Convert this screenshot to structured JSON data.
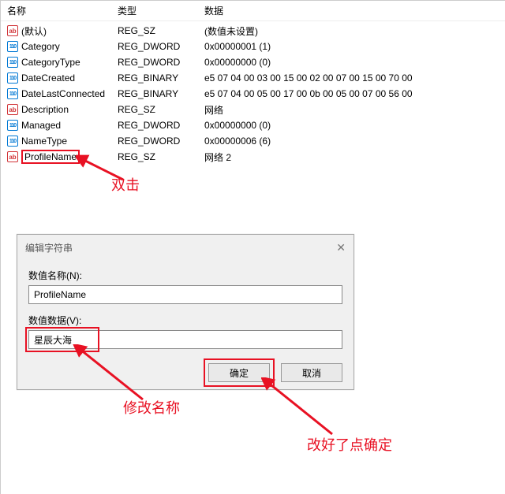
{
  "headers": {
    "name": "名称",
    "type": "类型",
    "data": "数据"
  },
  "rows": [
    {
      "icon": "sz",
      "name": "(默认)",
      "type": "REG_SZ",
      "data": "(数值未设置)"
    },
    {
      "icon": "bin",
      "name": "Category",
      "type": "REG_DWORD",
      "data": "0x00000001 (1)"
    },
    {
      "icon": "bin",
      "name": "CategoryType",
      "type": "REG_DWORD",
      "data": "0x00000000 (0)"
    },
    {
      "icon": "bin",
      "name": "DateCreated",
      "type": "REG_BINARY",
      "data": "e5 07 04 00 03 00 15 00 02 00 07 00 15 00 70 00"
    },
    {
      "icon": "bin",
      "name": "DateLastConnected",
      "type": "REG_BINARY",
      "data": "e5 07 04 00 05 00 17 00 0b 00 05 00 07 00 56 00"
    },
    {
      "icon": "sz",
      "name": "Description",
      "type": "REG_SZ",
      "data": "网络"
    },
    {
      "icon": "bin",
      "name": "Managed",
      "type": "REG_DWORD",
      "data": "0x00000000 (0)"
    },
    {
      "icon": "bin",
      "name": "NameType",
      "type": "REG_DWORD",
      "data": "0x00000006 (6)"
    },
    {
      "icon": "sz",
      "name": "ProfileName",
      "type": "REG_SZ",
      "data": "网络 2",
      "highlight": true
    }
  ],
  "annotations": {
    "doubleclick": "双击",
    "rename": "修改名称",
    "confirm": "改好了点确定"
  },
  "dialog": {
    "title": "编辑字符串",
    "name_label": "数值名称(N):",
    "name_value": "ProfileName",
    "data_label": "数值数据(V):",
    "data_value": "星辰大海",
    "ok": "确定",
    "cancel": "取消"
  },
  "icon_text": {
    "sz": "ab",
    "bin": "110"
  }
}
